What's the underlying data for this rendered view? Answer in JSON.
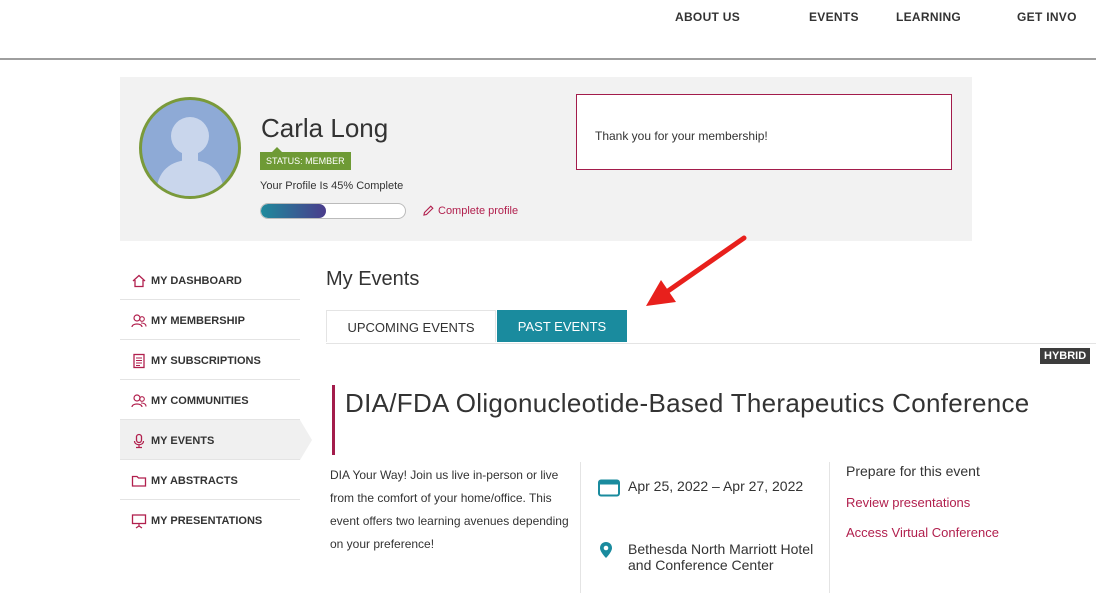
{
  "topnav": {
    "items": [
      "ABOUT US",
      "EVENTS",
      "LEARNING",
      "GET INVO"
    ]
  },
  "profile": {
    "name": "Carla Long",
    "status": "STATUS: MEMBER",
    "complete_text": "Your Profile Is 45% Complete",
    "progress_percent": 45,
    "complete_link": "Complete profile",
    "message": "Thank you for your membership!"
  },
  "sidebar": {
    "items": [
      {
        "label": "MY DASHBOARD",
        "icon": "home-icon"
      },
      {
        "label": "MY MEMBERSHIP",
        "icon": "members-icon"
      },
      {
        "label": "MY SUBSCRIPTIONS",
        "icon": "document-icon"
      },
      {
        "label": "MY COMMUNITIES",
        "icon": "members-icon"
      },
      {
        "label": "MY EVENTS",
        "icon": "microphone-icon"
      },
      {
        "label": "MY ABSTRACTS",
        "icon": "folder-icon"
      },
      {
        "label": "MY PRESENTATIONS",
        "icon": "presentation-icon"
      }
    ],
    "active": "MY EVENTS"
  },
  "main": {
    "title": "My Events",
    "tabs": [
      {
        "label": "UPCOMING EVENTS"
      },
      {
        "label": "PAST EVENTS"
      }
    ],
    "active_tab": "PAST EVENTS",
    "event": {
      "badge": "HYBRID",
      "title": "DIA/FDA Oligonucleotide-Based Therapeutics Conference",
      "description": "DIA Your Way! Join us live in-person or live from the comfort of your home/office. This event offers two learning avenues depending on your preference!",
      "date": "Apr 25, 2022 – Apr 27, 2022",
      "location": "Bethesda North Marriott Hotel and Conference Center",
      "prepare_title": "Prepare for this event",
      "links": [
        "Review presentations",
        "Access Virtual Conference"
      ]
    }
  },
  "colors": {
    "accent": "#1a8b9e",
    "link": "#b11f4d",
    "status": "#6e9a35",
    "annotation_arrow": "#e8201c"
  }
}
